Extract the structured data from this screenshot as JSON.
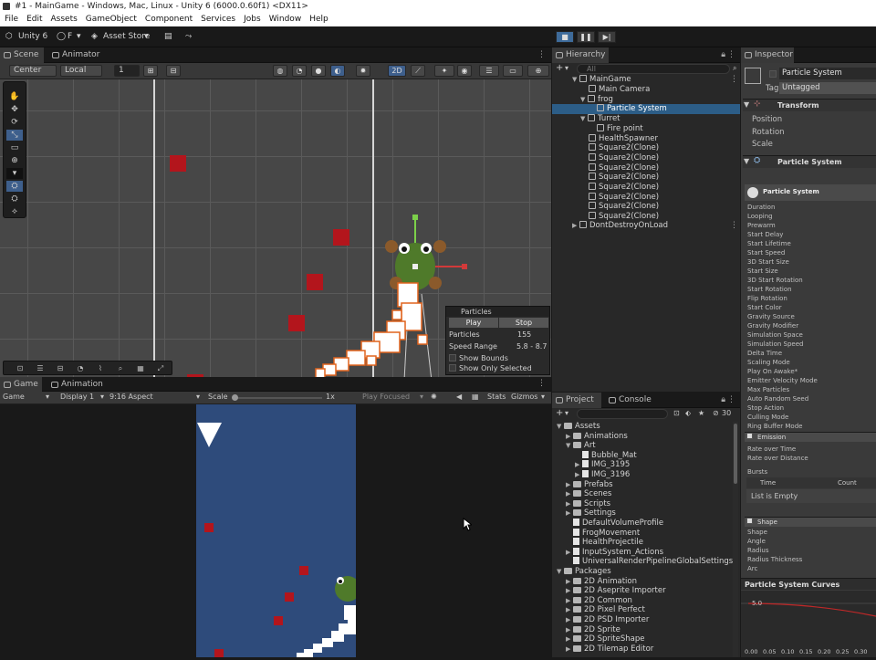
{
  "window": {
    "title": "#1 - MainGame - Windows, Mac, Linux - Unity 6 (6000.0.60f1) <DX11>"
  },
  "menu": [
    "File",
    "Edit",
    "Assets",
    "GameObject",
    "Component",
    "Services",
    "Jobs",
    "Window",
    "Help"
  ],
  "toolbar": {
    "unity_label": "Unity 6",
    "account": "F",
    "asset_store": "Asset Store"
  },
  "scene": {
    "tabs": {
      "scene": "Scene",
      "animator": "Animator"
    },
    "pivot": "Center",
    "space": "Local",
    "snap_value": "1",
    "mode_2d": "2D",
    "tools": [
      "✋",
      "✥",
      "⟳",
      "⤡",
      "▭",
      "⊕",
      "▾",
      "⛭",
      "⟡",
      "⛭"
    ]
  },
  "particles_overlay": {
    "title": "Particles",
    "play": "Play",
    "stop": "Stop",
    "particles_label": "Particles",
    "particles_value": "155",
    "speed_label": "Speed Range",
    "speed_value": "5.8 - 8.7",
    "show_bounds": "Show Bounds",
    "show_only_selected": "Show Only Selected"
  },
  "game": {
    "tabs": {
      "game": "Game",
      "animation": "Animation"
    },
    "display_mode": "Game",
    "display": "Display 1",
    "aspect": "9:16 Aspect",
    "scale_label": "Scale",
    "scale_value": "1x",
    "play_mode": "Play Focused",
    "stats": "Stats",
    "gizmos": "Gizmos"
  },
  "hierarchy": {
    "tab": "Hierarchy",
    "search_placeholder": "All",
    "items": [
      {
        "label": "MainGame"
      },
      {
        "label": "Main Camera"
      },
      {
        "label": "frog"
      },
      {
        "label": "Particle System"
      },
      {
        "label": "Turret"
      },
      {
        "label": "Fire point"
      },
      {
        "label": "HealthSpawner"
      },
      {
        "label": "Square2(Clone)"
      },
      {
        "label": "Square2(Clone)"
      },
      {
        "label": "Square2(Clone)"
      },
      {
        "label": "Square2(Clone)"
      },
      {
        "label": "Square2(Clone)"
      },
      {
        "label": "Square2(Clone)"
      },
      {
        "label": "Square2(Clone)"
      },
      {
        "label": "Square2(Clone)"
      },
      {
        "label": "DontDestroyOnLoad"
      }
    ]
  },
  "project": {
    "tabs": {
      "project": "Project",
      "console": "Console"
    },
    "hidden_count": "30",
    "items": [
      {
        "label": "Assets"
      },
      {
        "label": "Animations"
      },
      {
        "label": "Art"
      },
      {
        "label": "Bubble_Mat"
      },
      {
        "label": "IMG_3195"
      },
      {
        "label": "IMG_3196"
      },
      {
        "label": "Prefabs"
      },
      {
        "label": "Scenes"
      },
      {
        "label": "Scripts"
      },
      {
        "label": "Settings"
      },
      {
        "label": "DefaultVolumeProfile"
      },
      {
        "label": "FrogMovement"
      },
      {
        "label": "HealthProjectile"
      },
      {
        "label": "InputSystem_Actions"
      },
      {
        "label": "UniversalRenderPipelineGlobalSettings"
      },
      {
        "label": "Packages"
      },
      {
        "label": "2D Animation"
      },
      {
        "label": "2D Aseprite Importer"
      },
      {
        "label": "2D Common"
      },
      {
        "label": "2D Pixel Perfect"
      },
      {
        "label": "2D PSD Importer"
      },
      {
        "label": "2D Sprite"
      },
      {
        "label": "2D SpriteShape"
      },
      {
        "label": "2D Tilemap Editor"
      }
    ]
  },
  "inspector": {
    "tab": "Inspector",
    "object_name": "Particle System",
    "tag_label": "Tag",
    "tag_value": "Untagged",
    "transform": {
      "title": "Transform",
      "fields": [
        "Position",
        "Rotation",
        "Scale"
      ]
    },
    "particle_system_title": "Particle System",
    "main_module": "Particle System",
    "props": [
      "Duration",
      "Looping",
      "Prewarm",
      "Start Delay",
      "Start Lifetime",
      "Start Speed",
      "3D Start Size",
      "Start Size",
      "3D Start Rotation",
      "Start Rotation",
      "Flip Rotation",
      "Start Color",
      "Gravity Source",
      "Gravity Modifier",
      "Simulation Space",
      "Simulation Speed",
      "Delta Time",
      "Scaling Mode",
      "Play On Awake*",
      "Emitter Velocity Mode",
      "Max Particles",
      "Auto Random Seed",
      "Stop Action",
      "Culling Mode",
      "Ring Buffer Mode"
    ],
    "emission": {
      "title": "Emission",
      "rate_time": "Rate over Time",
      "rate_distance": "Rate over Distance",
      "bursts": "Bursts",
      "col_time": "Time",
      "col_count": "Count",
      "empty": "List is Empty"
    },
    "shape": {
      "title": "Shape",
      "props": [
        "Shape",
        "Angle",
        "Radius",
        "Radius Thickness",
        "Arc"
      ]
    },
    "curves": {
      "title": "Particle System Curves",
      "y_value": "5.0",
      "x_ticks": [
        "0.00",
        "0.05",
        "0.10",
        "0.15",
        "0.20",
        "0.25",
        "0.30"
      ]
    }
  }
}
